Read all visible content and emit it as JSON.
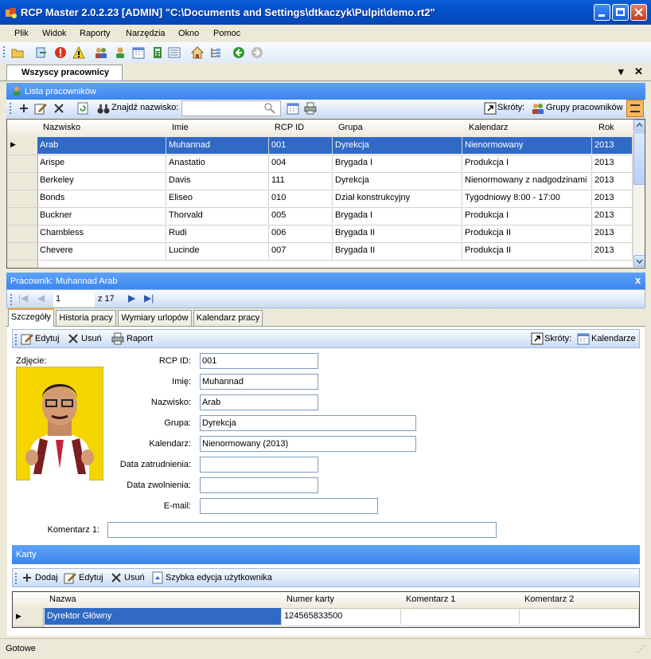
{
  "window": {
    "title": "RCP Master 2.0.2.23  [ADMIN] \"C:\\Documents and Settings\\dtkaczyk\\Pulpit\\demo.rt2\""
  },
  "menu": [
    "Plik",
    "Widok",
    "Raporty",
    "Narzędzia",
    "Okno",
    "Pomoc"
  ],
  "doc_tab": "Wszyscy pracownicy",
  "list_panel": {
    "title": "Lista pracowników",
    "find_label": "Znajdź nazwisko:",
    "find_value": "",
    "shortcuts_label": "Skróty:",
    "groups_link": "Grupy pracowników",
    "columns": [
      "Nazwisko",
      "Imie",
      "RCP ID",
      "Grupa",
      "Kalendarz",
      "Rok"
    ],
    "rows": [
      [
        "Arab",
        "Muhannad",
        "001",
        "Dyrekcja",
        "Nienormowany",
        "2013"
      ],
      [
        "Arispe",
        "Anastatio",
        "004",
        "Brygada I",
        "Produkcja I",
        "2013"
      ],
      [
        "Berkeley",
        "Davis",
        "111",
        "Dyrekcja",
        "Nienormowany z nadgodzinami",
        "2013"
      ],
      [
        "Bonds",
        "Eliseo",
        "010",
        "Dział konstrukcyjny",
        "Tygodniowy 8:00 - 17:00",
        "2013"
      ],
      [
        "Buckner",
        "Thorvald",
        "005",
        "Brygada I",
        "Produkcja I",
        "2013"
      ],
      [
        "Chambless",
        "Rudi",
        "006",
        "Brygada II",
        "Produkcja II",
        "2013"
      ],
      [
        "Chevere",
        "Lucinde",
        "007",
        "Brygada II",
        "Produkcja II",
        "2013"
      ]
    ]
  },
  "detail_panel": {
    "title": "Pracownik: Muhannad Arab",
    "close": "x",
    "nav_position": "1",
    "nav_total": "z 17",
    "tabs": [
      "Szczegóły",
      "Historia pracy",
      "Wymiary urlopów",
      "Kalendarz pracy"
    ],
    "toolbar": {
      "edit": "Edytuj",
      "delete": "Usuń",
      "report": "Raport",
      "shortcuts": "Skróty:",
      "calendars": "Kalendarze"
    },
    "photo_label": "Zdjęcie:",
    "fields": {
      "rcp_id": {
        "label": "RCP ID:",
        "value": "001"
      },
      "imie": {
        "label": "Imię:",
        "value": "Muhannad"
      },
      "nazwisko": {
        "label": "Nazwisko:",
        "value": "Arab"
      },
      "grupa": {
        "label": "Grupa:",
        "value": "Dyrekcja"
      },
      "kalendarz": {
        "label": "Kalendarz:",
        "value": "Nienormowany  (2013)"
      },
      "data_zatrudnienia": {
        "label": "Data zatrudnienia:",
        "value": ""
      },
      "data_zwolnienia": {
        "label": "Data zwolnienia:",
        "value": ""
      },
      "email": {
        "label": "E-mail:",
        "value": ""
      },
      "komentarz": {
        "label": "Komentarz 1:",
        "value": ""
      }
    },
    "cards": {
      "title": "Karty",
      "toolbar": {
        "add": "Dodaj",
        "edit": "Edytuj",
        "delete": "Usuń",
        "quick_edit": "Szybka edycja użytkownika"
      },
      "columns": [
        "Nazwa",
        "Numer karty",
        "Komentarz 1",
        "Komentarz 2"
      ],
      "rows": [
        [
          "Dyrektor Główny",
          "124565833500",
          "",
          ""
        ]
      ]
    }
  },
  "status": "Gotowe",
  "colors": {
    "title_bar": "#0550c8",
    "selection": "#316ac5",
    "panel_header": "#3c86ef"
  }
}
